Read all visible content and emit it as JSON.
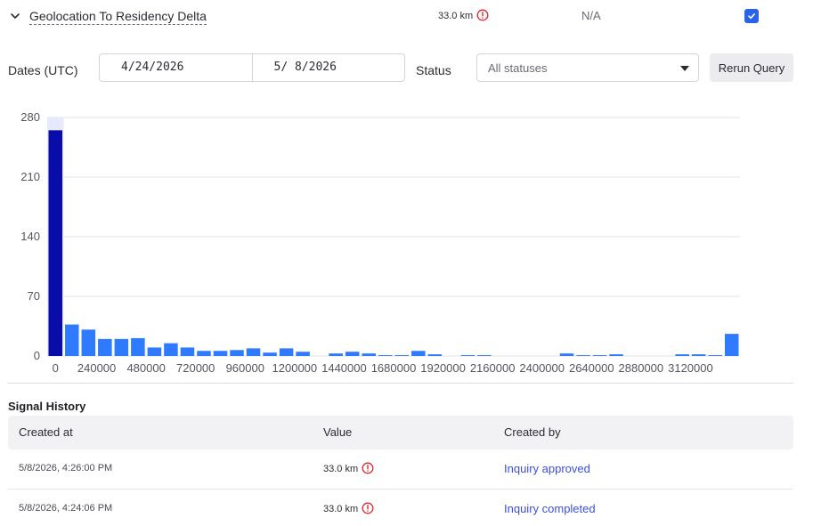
{
  "signal": {
    "name": "Geolocation To Residency Delta",
    "value": "33.0 km",
    "previous": "N/A",
    "checked": true
  },
  "filters": {
    "dates_label": "Dates (UTC)",
    "start_date": "4/24/2026",
    "end_date": "5/ 8/2026",
    "status_label": "Status",
    "status_value": "All statuses",
    "rerun_label": "Rerun Query"
  },
  "chart_data": {
    "type": "bar",
    "xlabel": "",
    "ylabel": "",
    "ylim": [
      0,
      280
    ],
    "y_ticks": [
      0,
      70,
      140,
      210,
      280
    ],
    "x_ticks": [
      0,
      240000,
      480000,
      720000,
      960000,
      1200000,
      1440000,
      1680000,
      1920000,
      2160000,
      2400000,
      2640000,
      2880000,
      3120000
    ],
    "bin_width": 80000,
    "highlight_index": 0,
    "grid": true,
    "colors": {
      "bar": "#2f7bff",
      "selected_bar": "#0a0ca8",
      "selected_band": "#e6e8fb"
    },
    "values": [
      265,
      37,
      31,
      20,
      20,
      21,
      10,
      15,
      10,
      6,
      6,
      7,
      9,
      4,
      9,
      5,
      0,
      3,
      5,
      3,
      1,
      1,
      6,
      2,
      0,
      1,
      1,
      0,
      0,
      0,
      0,
      3,
      1,
      1,
      2,
      0,
      0,
      0,
      2,
      2,
      1,
      26
    ]
  },
  "history": {
    "title": "Signal History",
    "columns": [
      "Created at",
      "Value",
      "Created by"
    ],
    "rows": [
      {
        "created_at": "5/8/2026, 4:26:00 PM",
        "value": "33.0 km",
        "created_by": "Inquiry approved"
      },
      {
        "created_at": "5/8/2026, 4:24:06 PM",
        "value": "33.0 km",
        "created_by": "Inquiry completed"
      }
    ]
  },
  "icons": {
    "alert": "alert-circle-icon",
    "chevron": "chevron-down-icon",
    "check": "check-icon",
    "caret": "caret-down-icon"
  },
  "accent_color": "#2a62e8",
  "alert_color": "#e0272e",
  "link_color": "#3b50e0"
}
